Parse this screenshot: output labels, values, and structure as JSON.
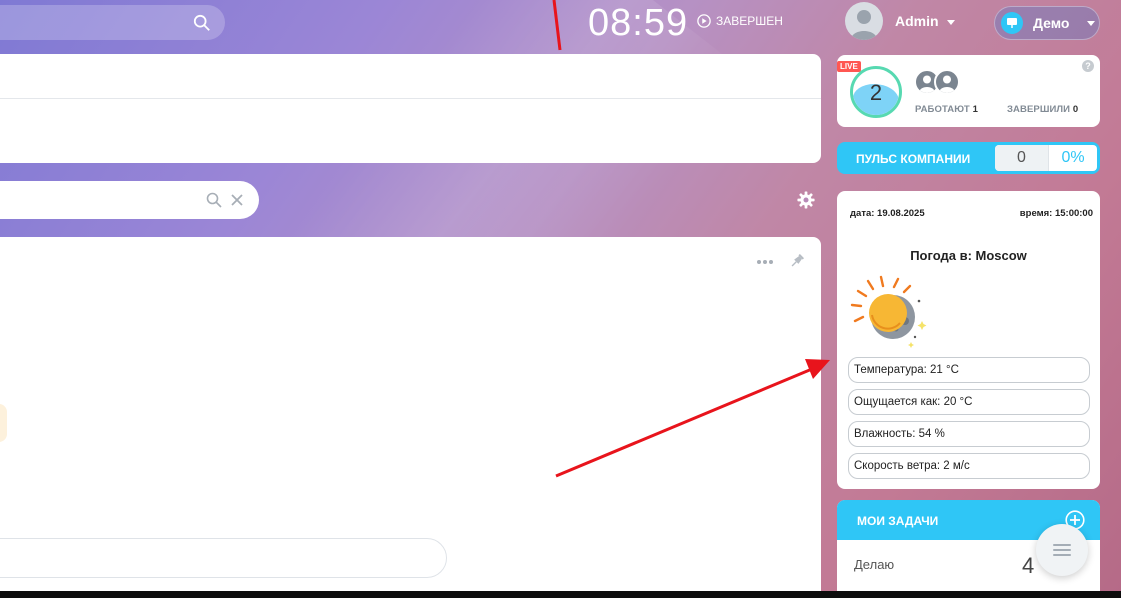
{
  "header": {
    "clock": "08:59",
    "status": "ЗАВЕРШЕН",
    "user_name": "Admin",
    "portal": "Демо"
  },
  "live": {
    "badge": "LIVE",
    "count": "2",
    "working_label": "РАБОТАЮТ",
    "working_value": "1",
    "finished_label": "ЗАВЕРШИЛИ",
    "finished_value": "0",
    "help": "?"
  },
  "pulse": {
    "label": "ПУЛЬС КОМПАНИИ",
    "value": "0",
    "percent": "0%"
  },
  "weather": {
    "date": "дата: 19.08.2025",
    "time": "время: 15:00:00",
    "city": "Погода в: Moscow",
    "rows": [
      "Температура: 21 °C",
      "Ощущается как: 20 °C",
      "Влажность: 54 %",
      "Скорость ветра: 2 м/с"
    ]
  },
  "tasks": {
    "title": "МОИ ЗАДАЧИ",
    "row_label": "Делаю",
    "row_value": "4"
  },
  "colors": {
    "accent": "#2fc6f6",
    "live_red": "#ff5752",
    "annotation_red": "#e8141c"
  },
  "icons": [
    "search-icon",
    "play-icon",
    "avatar-icon",
    "chevron-down-icon",
    "presentation-icon",
    "close-icon",
    "gear-icon",
    "more-dots-icon",
    "pin-icon",
    "weather-sun-moon-icon",
    "add-icon",
    "list-icon"
  ]
}
